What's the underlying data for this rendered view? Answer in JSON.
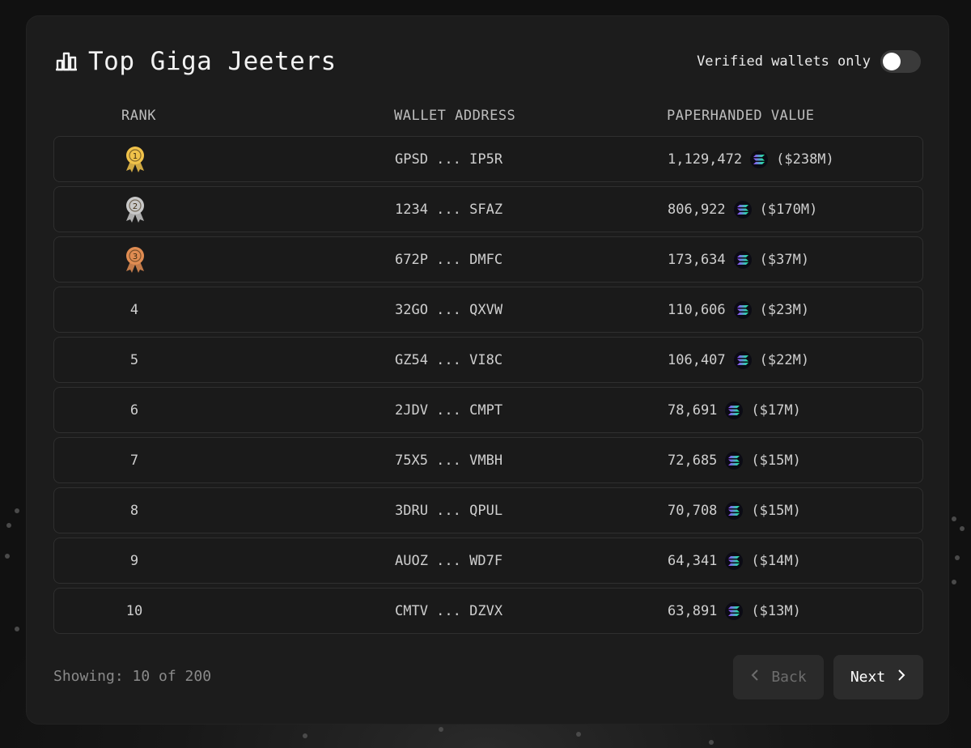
{
  "header": {
    "title": "Top Giga Jeeters",
    "title_icon": "bar-chart-icon",
    "toggle_label": "Verified wallets only",
    "toggle_on": false
  },
  "columns": {
    "rank": "RANK",
    "wallet": "WALLET ADDRESS",
    "value": "PAPERHANDED VALUE"
  },
  "rows": [
    {
      "rank": "1",
      "medal": "gold-medal-icon",
      "wallet": "GPSD ... IP5R",
      "amount": "1,129,472",
      "usd": "($238M)"
    },
    {
      "rank": "2",
      "medal": "silver-medal-icon",
      "wallet": "1234 ... SFAZ",
      "amount": "806,922",
      "usd": "($170M)"
    },
    {
      "rank": "3",
      "medal": "bronze-medal-icon",
      "wallet": "672P ... DMFC",
      "amount": "173,634",
      "usd": "($37M)"
    },
    {
      "rank": "4",
      "wallet": "32GO ... QXVW",
      "amount": "110,606",
      "usd": "($23M)"
    },
    {
      "rank": "5",
      "wallet": "GZ54 ... VI8C",
      "amount": "106,407",
      "usd": "($22M)"
    },
    {
      "rank": "6",
      "wallet": "2JDV ... CMPT",
      "amount": "78,691",
      "usd": "($17M)"
    },
    {
      "rank": "7",
      "wallet": "75X5 ... VMBH",
      "amount": "72,685",
      "usd": "($15M)"
    },
    {
      "rank": "8",
      "wallet": "3DRU ... QPUL",
      "amount": "70,708",
      "usd": "($15M)"
    },
    {
      "rank": "9",
      "wallet": "AUOZ ... WD7F",
      "amount": "64,341",
      "usd": "($14M)"
    },
    {
      "rank": "10",
      "wallet": "CMTV ... DZVX",
      "amount": "63,891",
      "usd": "($13M)"
    }
  ],
  "footer": {
    "showing": "Showing: 10 of 200",
    "back_label": "Back",
    "next_label": "Next"
  },
  "colors": {
    "gold": "#f0c24a",
    "silver": "#c8c8c8",
    "bronze": "#e08c52",
    "solana_gradient": [
      "#9945ff",
      "#14f195"
    ]
  }
}
